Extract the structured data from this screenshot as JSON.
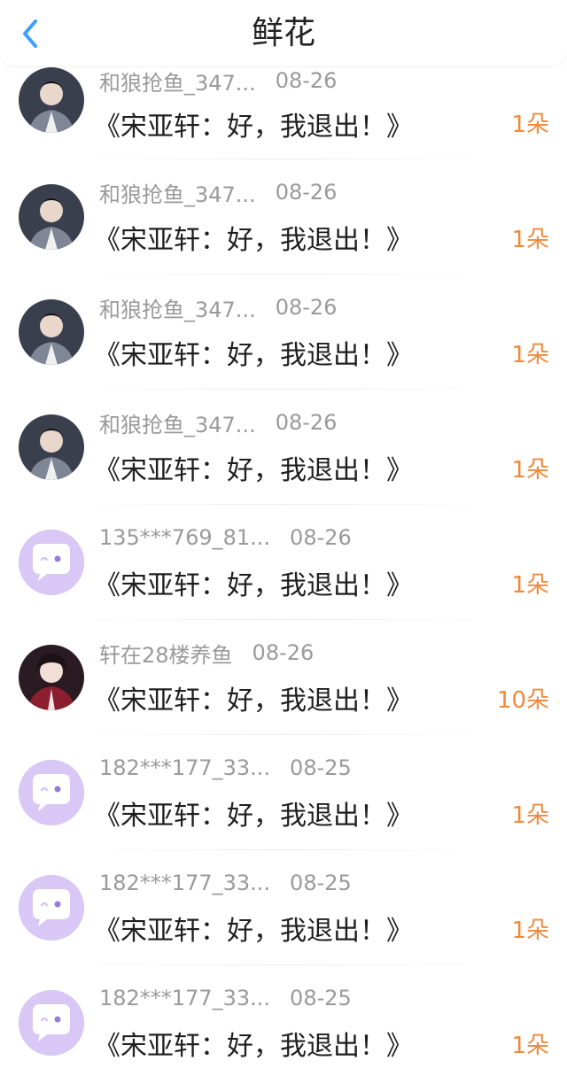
{
  "header": {
    "title": "鲜花"
  },
  "theme": {
    "accent": "#3aa0ff",
    "count_color": "#f08a3c",
    "placeholder_avatar_bg": "#d9c7f5"
  },
  "rows": [
    {
      "name": "和狼抢鱼_347...",
      "date": "08-26",
      "message": "《宋亚轩：好，我退出！》",
      "count": "1朵",
      "avatar": "photo-boy-dark"
    },
    {
      "name": "和狼抢鱼_347...",
      "date": "08-26",
      "message": "《宋亚轩：好，我退出！》",
      "count": "1朵",
      "avatar": "photo-boy-dark"
    },
    {
      "name": "和狼抢鱼_347...",
      "date": "08-26",
      "message": "《宋亚轩：好，我退出！》",
      "count": "1朵",
      "avatar": "photo-boy-dark"
    },
    {
      "name": "和狼抢鱼_347...",
      "date": "08-26",
      "message": "《宋亚轩：好，我退出！》",
      "count": "1朵",
      "avatar": "photo-boy-dark"
    },
    {
      "name": "135***769_81...",
      "date": "08-26",
      "message": "《宋亚轩：好，我退出！》",
      "count": "1朵",
      "avatar": "chat-bubble-icon"
    },
    {
      "name": "轩在28楼养鱼",
      "date": "08-26",
      "message": "《宋亚轩：好，我退出！》",
      "count": "10朵",
      "avatar": "photo-boy-red"
    },
    {
      "name": "182***177_33...",
      "date": "08-25",
      "message": "《宋亚轩：好，我退出！》",
      "count": "1朵",
      "avatar": "chat-bubble-icon"
    },
    {
      "name": "182***177_33...",
      "date": "08-25",
      "message": "《宋亚轩：好，我退出！》",
      "count": "1朵",
      "avatar": "chat-bubble-icon"
    },
    {
      "name": "182***177_33...",
      "date": "08-25",
      "message": "《宋亚轩：好，我退出！》",
      "count": "1朵",
      "avatar": "chat-bubble-icon"
    }
  ]
}
